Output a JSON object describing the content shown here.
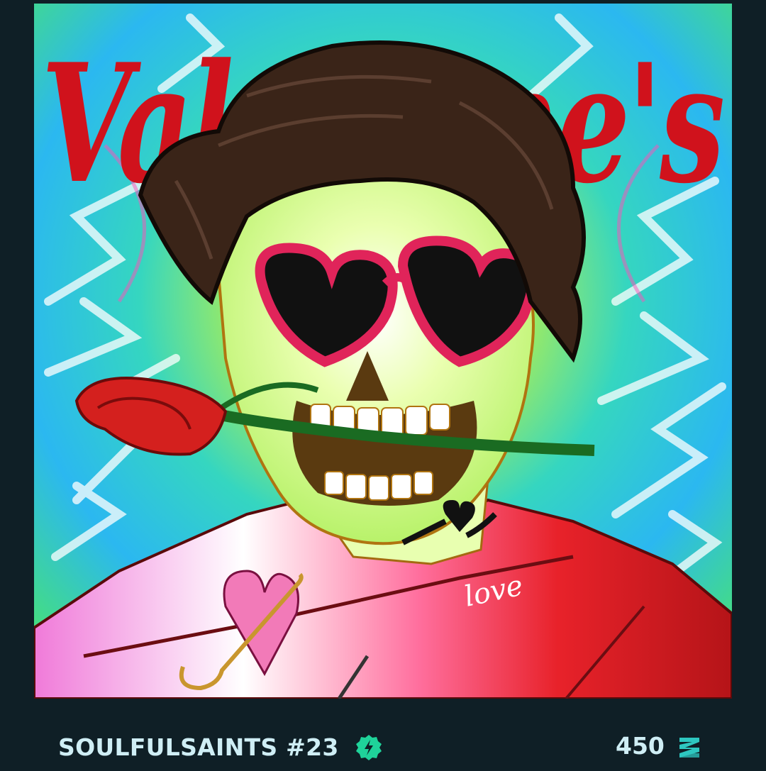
{
  "nft": {
    "name": "SOULFULSAINTS #23",
    "artwork_text": "Valentine's",
    "shirt_text": "love",
    "verified_icon": "verified-badge-icon",
    "currency_icon": "zilliqa-icon"
  },
  "price": {
    "value": "450"
  },
  "colors": {
    "background": "#0f1f26",
    "text": "#cfeef5",
    "badge": "#1fd39a",
    "currency": "#2ec7c0"
  }
}
